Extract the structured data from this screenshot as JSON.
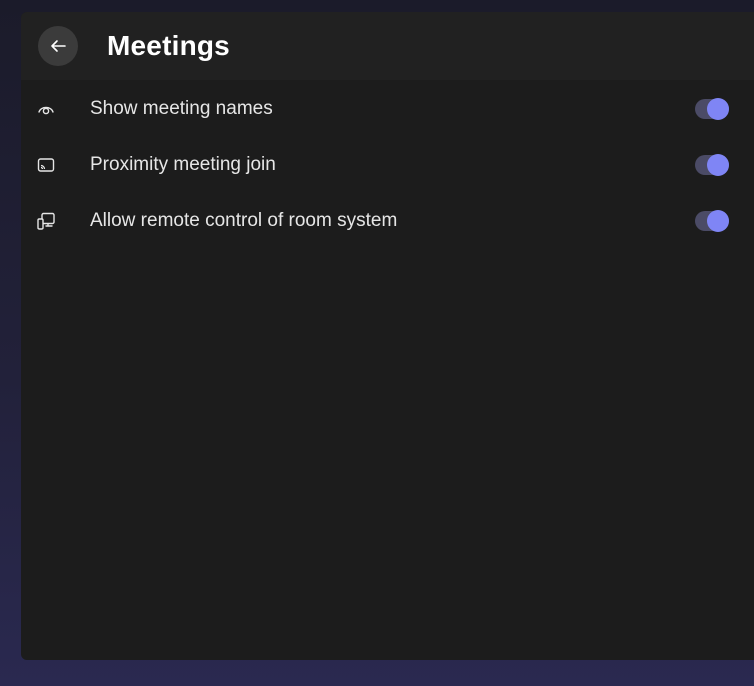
{
  "header": {
    "title": "Meetings",
    "back_icon": "arrow-left-icon"
  },
  "settings": [
    {
      "label": "Show meeting names",
      "icon": "eye-icon",
      "enabled": true
    },
    {
      "label": "Proximity meeting join",
      "icon": "cast-icon",
      "enabled": true
    },
    {
      "label": "Allow remote control of room system",
      "icon": "remote-device-icon",
      "enabled": true
    }
  ],
  "colors": {
    "accent": "#7f85f5",
    "panel": "#1c1c1c",
    "header": "#212121",
    "text": "#e6e6e6"
  }
}
